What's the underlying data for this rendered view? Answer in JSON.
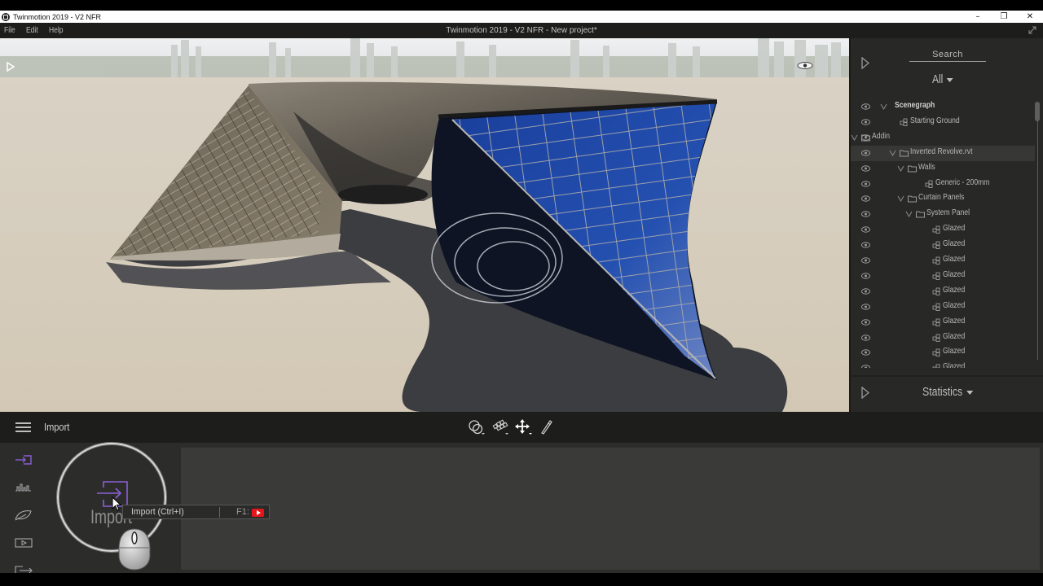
{
  "os_window": {
    "title": "Twinmotion 2019 - V2 NFR",
    "controls": [
      "minimize",
      "restore",
      "close"
    ]
  },
  "menubar": {
    "items": [
      "File",
      "Edit",
      "Help"
    ],
    "app_title": "Twinmotion 2019 - V2 NFR - New project*"
  },
  "viewport": {
    "scene_description": "Inverted Revolve architectural model on sand ground with city skyline",
    "colors": {
      "sky": "#e6e9ea",
      "ground": "#d7cdbd",
      "glass": "#1f4aa8",
      "shadow": "#3a3a3c",
      "roof": "#5f5a52"
    }
  },
  "right_panel": {
    "search_label": "Search",
    "filter_value": "All",
    "tree": [
      {
        "label": "Scenegraph",
        "level": 0,
        "type": "root",
        "expanded": true,
        "bold": true
      },
      {
        "label": "Starting Ground",
        "level": 1,
        "type": "object"
      },
      {
        "label": "Addin",
        "level": 1,
        "type": "folder",
        "expanded": true
      },
      {
        "label": "Inverted Revolve.rvt",
        "level": 2,
        "type": "folder",
        "expanded": true,
        "selected": true
      },
      {
        "label": "Walls",
        "level": 3,
        "type": "folder",
        "expanded": true
      },
      {
        "label": "Generic - 200mm",
        "level": 4,
        "type": "object"
      },
      {
        "label": "Curtain Panels",
        "level": 3,
        "type": "folder",
        "expanded": true
      },
      {
        "label": "System Panel",
        "level": 4,
        "type": "folder",
        "expanded": true
      },
      {
        "label": "Glazed",
        "level": 5,
        "type": "object"
      },
      {
        "label": "Glazed",
        "level": 5,
        "type": "object"
      },
      {
        "label": "Glazed",
        "level": 5,
        "type": "object"
      },
      {
        "label": "Glazed",
        "level": 5,
        "type": "object"
      },
      {
        "label": "Glazed",
        "level": 5,
        "type": "object"
      },
      {
        "label": "Glazed",
        "level": 5,
        "type": "object"
      },
      {
        "label": "Glazed",
        "level": 5,
        "type": "object"
      },
      {
        "label": "Glazed",
        "level": 5,
        "type": "object"
      },
      {
        "label": "Glazed",
        "level": 5,
        "type": "object"
      },
      {
        "label": "Glazed",
        "level": 5,
        "type": "object"
      }
    ],
    "statistics_label": "Statistics"
  },
  "bottom_toolbar": {
    "section_title": "Import",
    "tools": [
      "selection-tool",
      "grid-tool",
      "move-tool",
      "eyedropper-tool"
    ]
  },
  "bottom_panel": {
    "side_icons": [
      "import",
      "audio",
      "nature",
      "media",
      "export"
    ],
    "active_side_icon": "import",
    "import_label": "Import",
    "tooltip": {
      "text": "Import (Ctrl+I)",
      "help_key": "F1:"
    },
    "accent_color": "#8b5fd6"
  }
}
